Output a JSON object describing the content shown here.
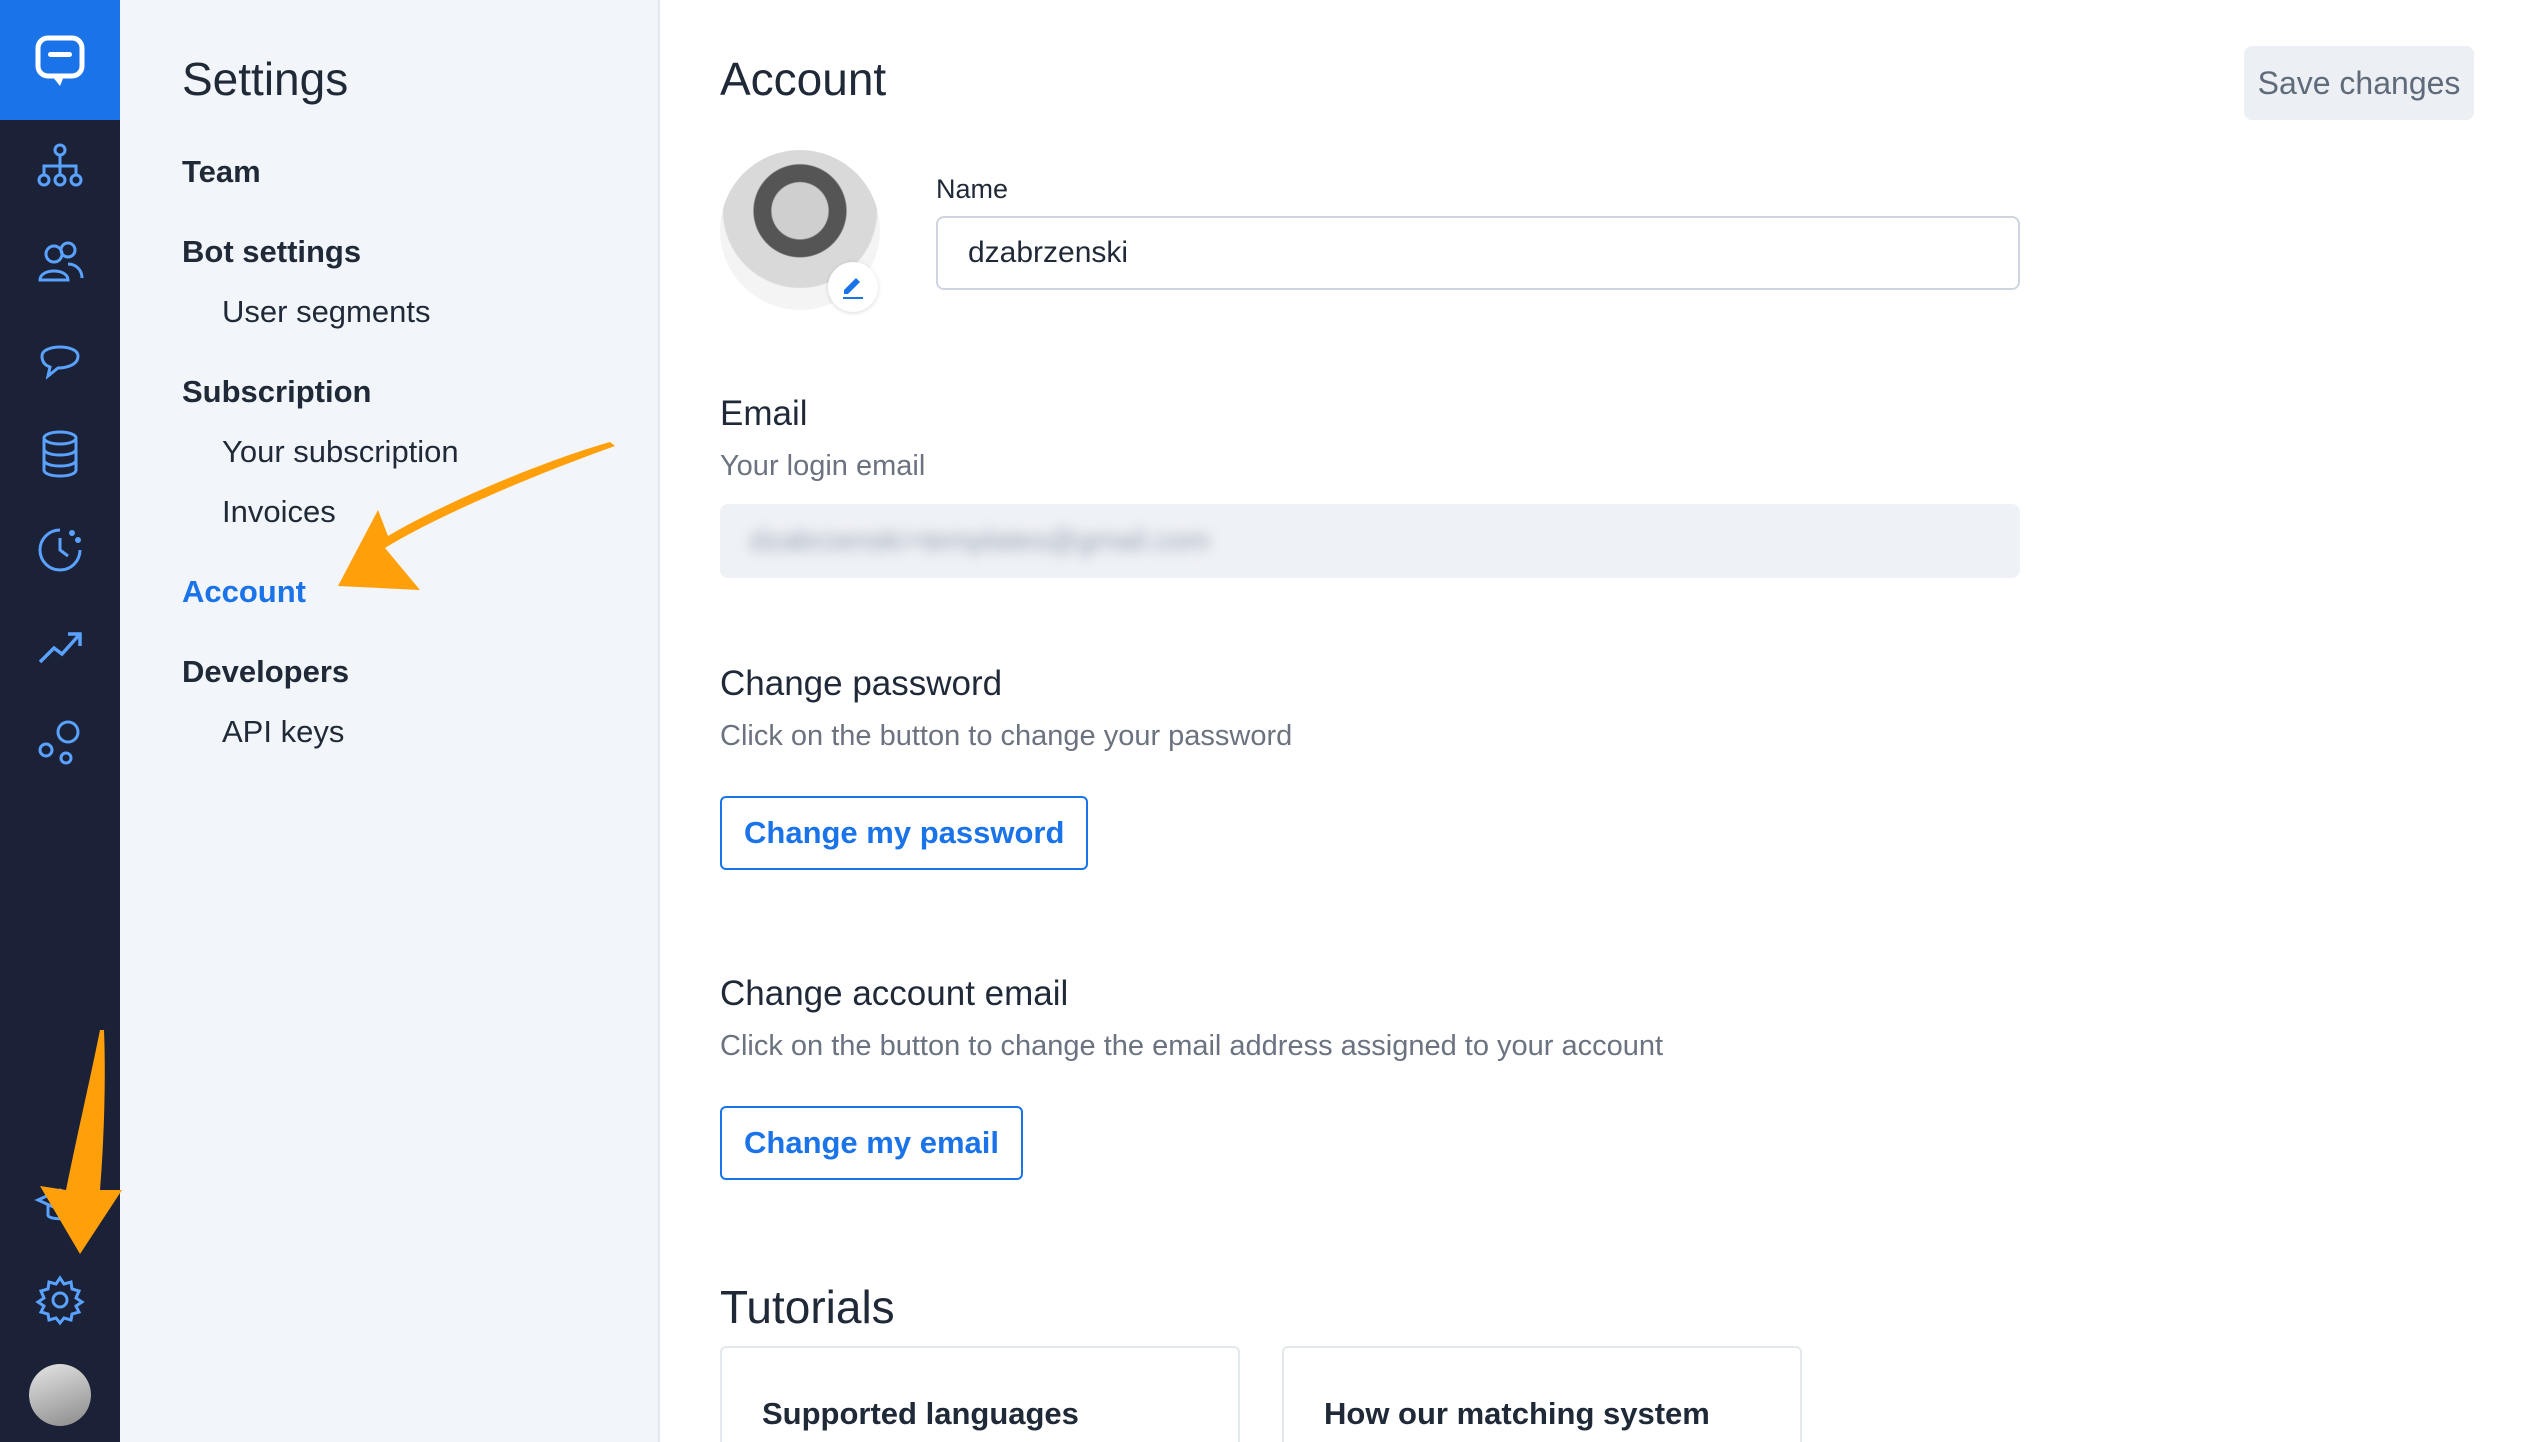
{
  "settings": {
    "title": "Settings",
    "items": [
      {
        "label": "Team",
        "kind": "section"
      },
      {
        "label": "Bot settings",
        "kind": "section"
      },
      {
        "label": "User segments",
        "kind": "sub"
      },
      {
        "label": "Subscription",
        "kind": "section"
      },
      {
        "label": "Your subscription",
        "kind": "sub"
      },
      {
        "label": "Invoices",
        "kind": "sub"
      },
      {
        "label": "Account",
        "kind": "section",
        "active": true
      },
      {
        "label": "Developers",
        "kind": "section"
      },
      {
        "label": "API keys",
        "kind": "sub"
      }
    ]
  },
  "rail": {
    "icons": [
      "chat-logo-icon",
      "hierarchy-icon",
      "users-icon",
      "chat-bubble-icon",
      "database-icon",
      "clock-history-icon",
      "trend-chart-icon",
      "bubbles-icon",
      "graduation-cap-icon",
      "gear-icon"
    ]
  },
  "main": {
    "title": "Account",
    "save_label": "Save changes",
    "name": {
      "label": "Name",
      "value": "dzabrzenski"
    },
    "email": {
      "title": "Email",
      "subtitle": "Your login email",
      "value": "dzabrzenski+templates@gmail.com"
    },
    "password": {
      "title": "Change password",
      "subtitle": "Click on the button to change your password",
      "button": "Change my password"
    },
    "change_email": {
      "title": "Change account email",
      "subtitle": "Click on the button to change the email address assigned to your account",
      "button": "Change my email"
    },
    "tutorials": {
      "title": "Tutorials",
      "cards": [
        "Supported languages",
        "How our matching system"
      ]
    }
  },
  "colors": {
    "accent": "#1a73e8",
    "rail_bg": "#1b2136",
    "annotation": "#ff9f0a"
  }
}
